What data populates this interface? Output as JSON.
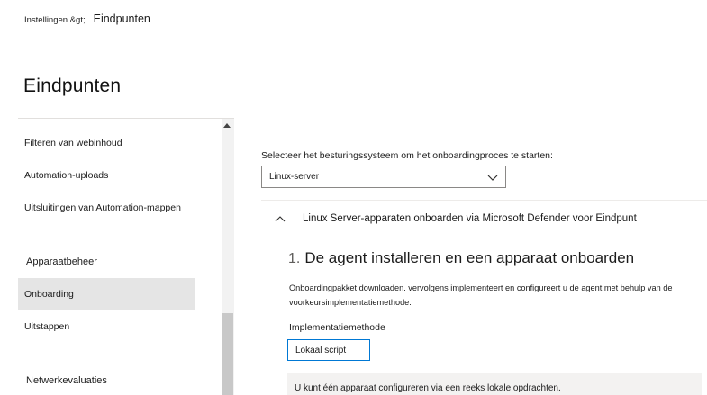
{
  "breadcrumb": {
    "parent": "Instellingen &gt;",
    "current": "Eindpunten"
  },
  "page": {
    "title": "Eindpunten"
  },
  "sidebar": {
    "items": [
      {
        "label": "Filteren van webinhoud"
      },
      {
        "label": "Automation-uploads"
      },
      {
        "label": "Uitsluitingen van Automation-mappen"
      }
    ],
    "groups": [
      {
        "label": "Apparaatbeheer",
        "items": [
          {
            "label": "Onboarding",
            "selected": true
          },
          {
            "label": "Uitstappen",
            "selected": false
          }
        ]
      },
      {
        "label": "Netwerkevaluaties"
      }
    ]
  },
  "content": {
    "select_label": "Selecteer het besturingssysteem om het onboardingproces te starten:",
    "os_selected": "Linux-server",
    "section_title": "Linux Server-apparaten onboarden via Microsoft Defender voor Eindpunt",
    "step": {
      "number": "1.",
      "title": "De agent installeren en een apparaat onboarden",
      "description": "Onboardingpakket downloaden. vervolgens implementeert en configureert u de agent met behulp van de voorkeursimplementatiemethode.",
      "method_label": "Implementatiemethode",
      "method_value": "Lokaal script",
      "info_text": "U kunt één apparaat configureren via een reeks lokale opdrachten."
    }
  },
  "icons": {
    "dropdown": "chevron-down-icon",
    "section": "chevron-up-icon",
    "scroll": "scroll-up-icon"
  },
  "colors": {
    "selected_bg": "#e5e5e5",
    "focus_border": "#0078d4",
    "info_bg": "#f3f2f1"
  }
}
